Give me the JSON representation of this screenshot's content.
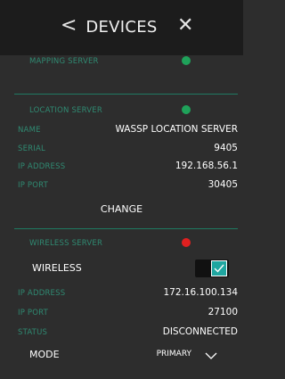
{
  "header": {
    "back_icon": "chevron-left-icon",
    "back_glyph": "<",
    "title": "DEVICES",
    "close_icon": "close-icon",
    "close_glyph": "✕"
  },
  "mapping_server": {
    "label": "MAPPING SERVER",
    "status_color": "#1fa25a"
  },
  "location_server": {
    "label": "LOCATION SERVER",
    "status_color": "#1fa25a",
    "fields": [
      {
        "label": "NAME",
        "value": "WASSP LOCATION SERVER"
      },
      {
        "label": "SERIAL",
        "value": "9405"
      },
      {
        "label": "IP ADDRESS",
        "value": "192.168.56.1"
      },
      {
        "label": "IP PORT",
        "value": "30405"
      }
    ],
    "change_label": "CHANGE"
  },
  "wireless_server": {
    "label": "WIRELESS SERVER",
    "status_color": "#e02020",
    "wireless_label": "WIRELESS",
    "wireless_enabled": true,
    "fields": [
      {
        "label": "IP ADDRESS",
        "value": "172.16.100.134"
      },
      {
        "label": "IP PORT",
        "value": "27100"
      },
      {
        "label": "STATUS",
        "value": "DISCONNECTED"
      }
    ],
    "mode_label": "MODE",
    "mode_value": "PRIMARY"
  },
  "colors": {
    "accent": "#2f8a72",
    "background": "#2d2d2d",
    "header": "#1c1c1c"
  }
}
